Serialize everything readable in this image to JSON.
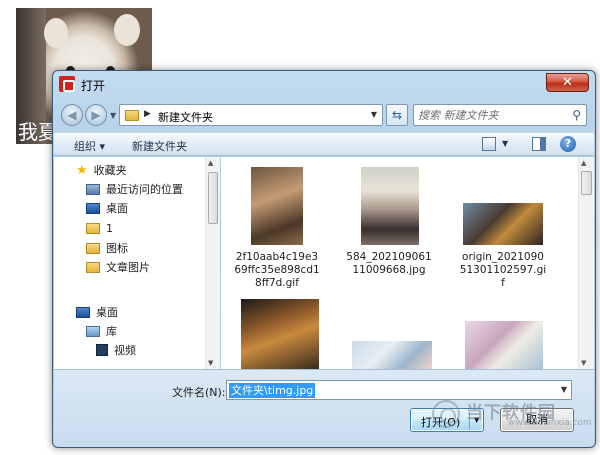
{
  "background": {
    "caption": "我夏"
  },
  "dialog": {
    "title": "打开",
    "close_glyph": "✕",
    "address": {
      "path": "新建文件夹",
      "separator": "▶"
    },
    "search": {
      "placeholder": "搜索 新建文件夹"
    },
    "toolbar": {
      "organize": "组织 ▾",
      "new_folder": "新建文件夹"
    },
    "nav": {
      "favorites": "收藏夹",
      "recent": "最近访问的位置",
      "desktop_fav": "桌面",
      "folder_1": "1",
      "icons": "图标",
      "doc_images": "文章图片",
      "desktop": "桌面",
      "library": "库",
      "video": "视频"
    },
    "files": [
      {
        "name_lines": [
          "2f10aab4c19e3",
          "69ffc35e898cd1",
          "8ff7d.gif"
        ]
      },
      {
        "name_lines": [
          "584_202109061",
          "11009668.jpg"
        ]
      },
      {
        "name_lines": [
          "origin_2021090",
          "51301102597.gi",
          "f"
        ]
      },
      {
        "name_lines": []
      },
      {
        "name_lines": []
      },
      {
        "name_lines": []
      }
    ],
    "filename": {
      "label": "文件名(N):",
      "value": "文件夹\\timg.jpg"
    },
    "buttons": {
      "open": "打开(O)",
      "cancel": "取消"
    },
    "help_glyph": "?"
  },
  "watermark": {
    "text": "当下软件园",
    "url": "www.downxia.com"
  },
  "colors": {
    "accent": "#3399ff",
    "frame": "#aecbe5",
    "close": "#c8402a"
  }
}
